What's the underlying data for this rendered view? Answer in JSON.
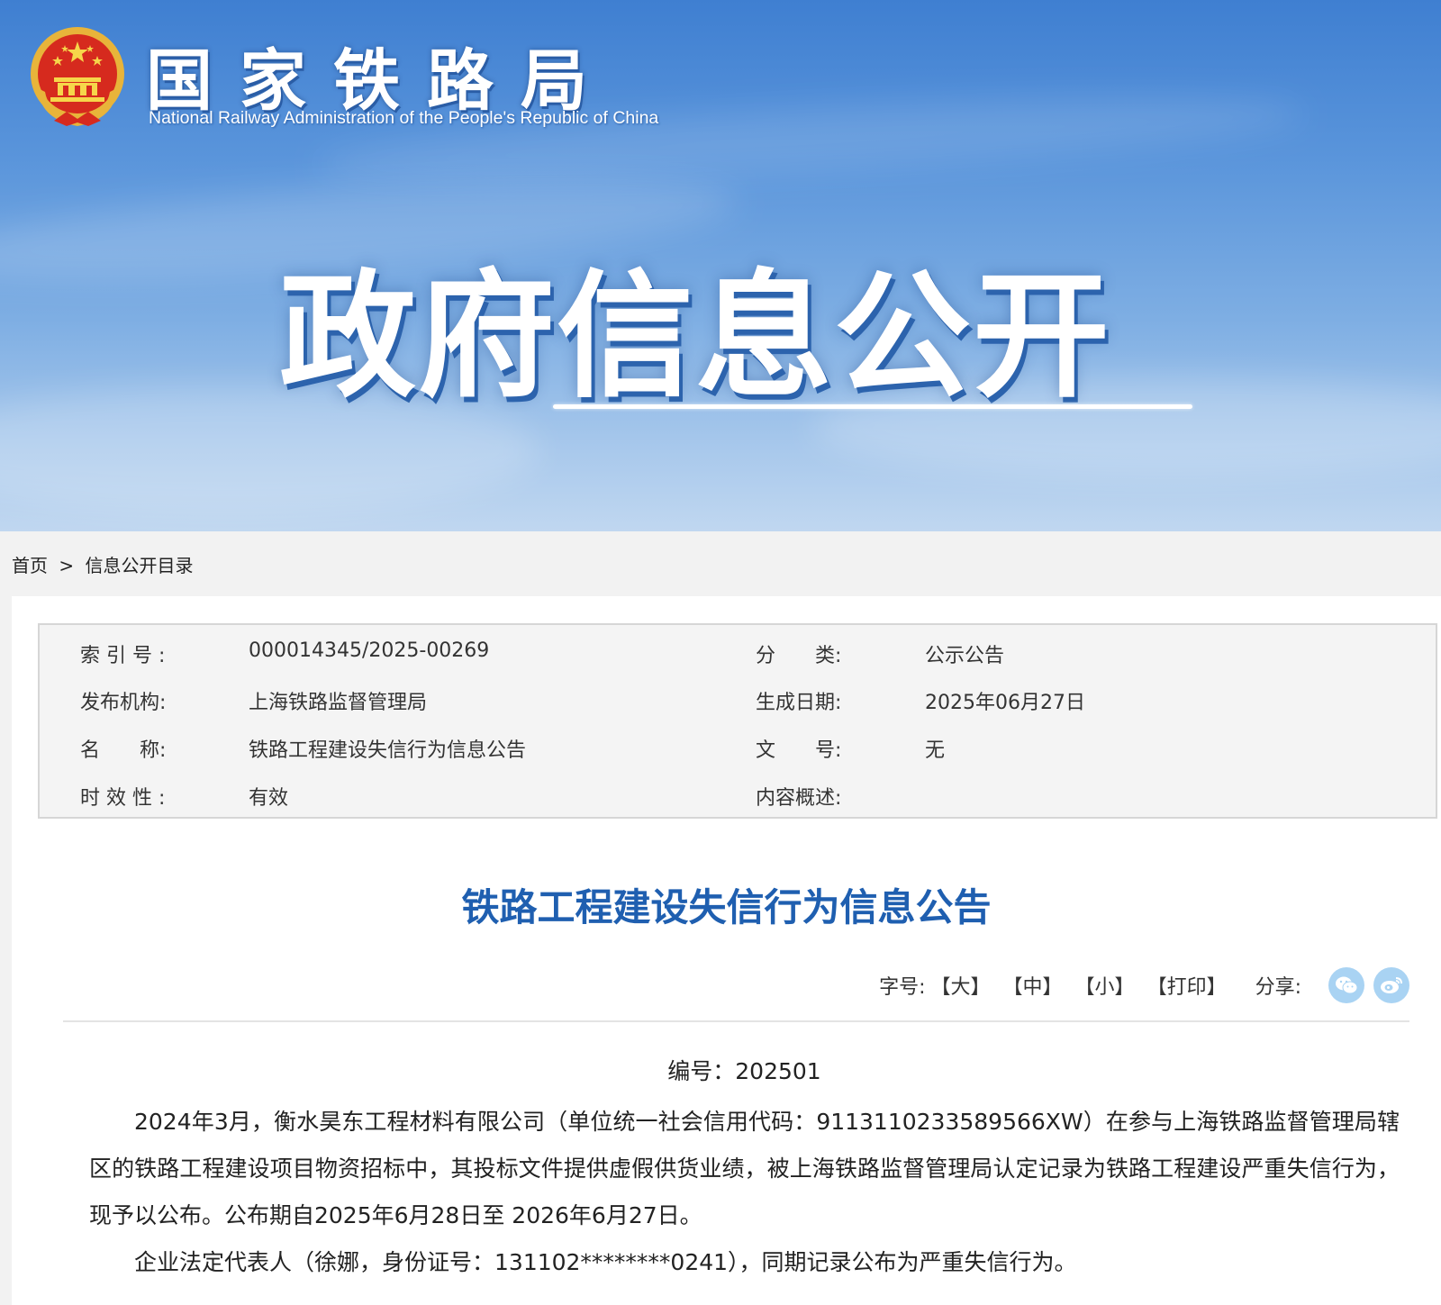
{
  "header": {
    "brand_cn": "国家铁路局",
    "brand_en": "National Railway Administration of the People's Republic of China",
    "banner_title": "政府信息公开"
  },
  "breadcrumb": {
    "home": "首页",
    "separator": ">",
    "current": "信息公开目录"
  },
  "meta": {
    "index_label": "索 引 号 :",
    "index_value": "000014345/2025-00269",
    "category_label": "分　　类:",
    "category_value": "公示公告",
    "publisher_label": "发布机构:",
    "publisher_value": "上海铁路监督管理局",
    "date_label": "生成日期:",
    "date_value": "2025年06月27日",
    "name_label": "名　　称:",
    "name_value": "铁路工程建设失信行为信息公告",
    "doc_label": "文　　号:",
    "doc_value": "无",
    "validity_label": "时 效 性 :",
    "validity_value": "有效",
    "summary_label": "内容概述:",
    "summary_value": ""
  },
  "article": {
    "title": "铁路工程建设失信行为信息公告",
    "doc_number": "编号：202501",
    "paragraphs": [
      "2024年3月，衡水昊东工程材料有限公司（单位统一社会信用代码：9113110233589566XW）在参与上海铁路监督管理局辖区的铁路工程建设项目物资招标中，其投标文件提供虚假供货业绩，被上海铁路监督管理局认定记录为铁路工程建设严重失信行为，现予以公布。公布期自2025年6月28日至 2026年6月27日。",
      "企业法定代表人（徐娜，身份证号：131102********0241），同期记录公布为严重失信行为。"
    ]
  },
  "toolbar": {
    "font_label": "字号:",
    "large": "【大】",
    "medium": "【中】",
    "small": "【小】",
    "print": "【打印】",
    "share_label": "分享:"
  },
  "icons": {
    "emblem": "national-emblem-icon",
    "share_wechat": "wechat-icon",
    "share_weibo": "weibo-icon"
  },
  "colors": {
    "title_blue": "#1f5fb0",
    "share_icon": "#a9d3f3"
  }
}
